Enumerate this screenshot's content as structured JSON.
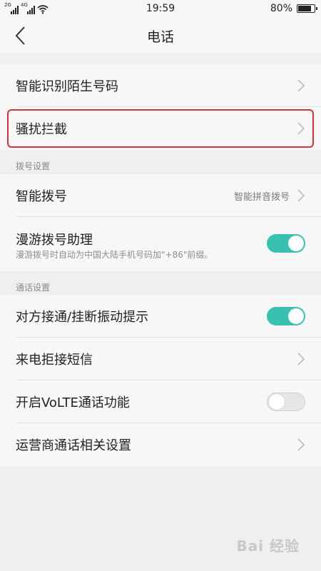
{
  "status_bar": {
    "sim1_tag": "2G",
    "sim2_tag": "4G",
    "time": "19:59",
    "battery_text": "80%",
    "battery_level": 0.8
  },
  "nav": {
    "title": "电话"
  },
  "group1": {
    "items": [
      {
        "label": "智能识别陌生号码"
      },
      {
        "label": "骚扰拦截"
      }
    ]
  },
  "section_dial": {
    "header": "拨号设置",
    "items": [
      {
        "label": "智能拨号",
        "value": "智能拼音拨号"
      },
      {
        "label": "漫游拨号助理",
        "sub": "漫游拨号时自动为中国大陆手机号码加\"+86\"前缀。",
        "toggle": "on"
      }
    ]
  },
  "section_call": {
    "header": "通话设置",
    "items": [
      {
        "label": "对方接通/挂断振动提示",
        "toggle": "on"
      },
      {
        "label": "来电拒接短信"
      },
      {
        "label": "开启VoLTE通话功能",
        "toggle": "off"
      },
      {
        "label": "运营商通话相关设置"
      }
    ]
  },
  "watermark": "Bai 经验",
  "colors": {
    "accent": "#39c1b0",
    "highlight": "#d3333d",
    "background": "#efefef",
    "panel": "#f7f7f7"
  }
}
